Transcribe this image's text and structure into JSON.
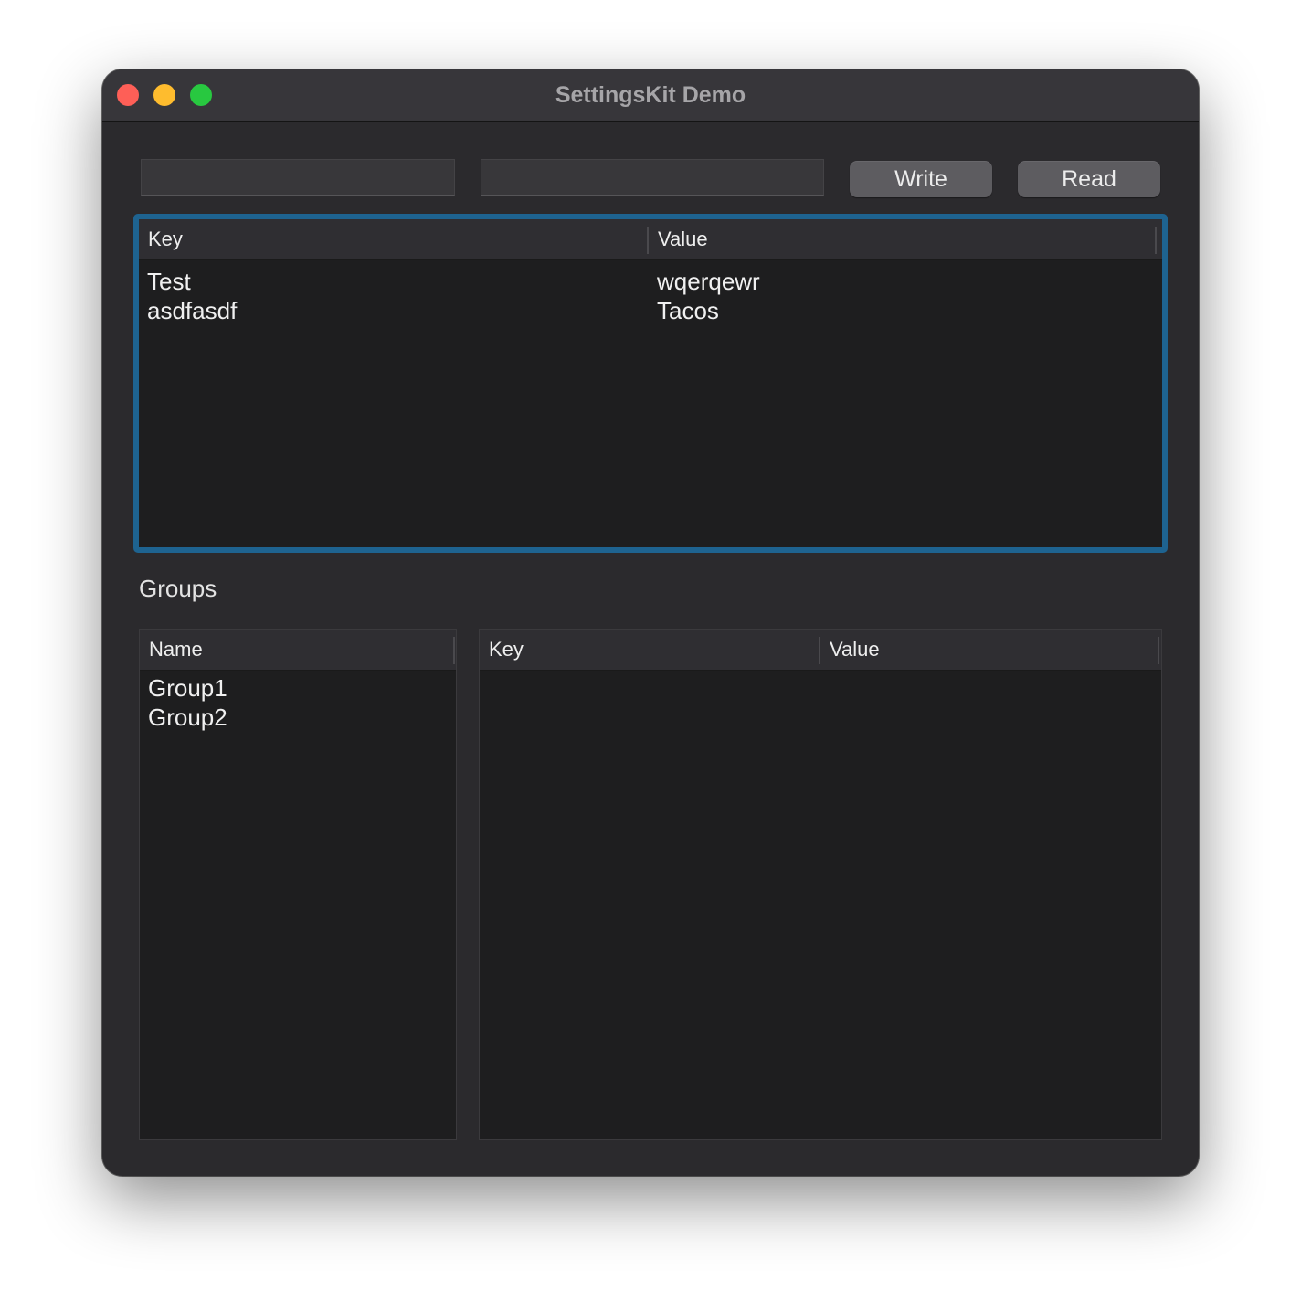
{
  "window": {
    "title": "SettingsKit Demo"
  },
  "toolbar": {
    "key_input_value": "",
    "value_input_value": "",
    "write_label": "Write",
    "read_label": "Read"
  },
  "settings_table": {
    "columns": [
      "Key",
      "Value"
    ],
    "rows": [
      {
        "key": "Test",
        "value": "wqerqewr"
      },
      {
        "key": "asdfasdf",
        "value": "Tacos"
      }
    ]
  },
  "groups": {
    "label": "Groups",
    "names_table": {
      "columns": [
        "Name"
      ],
      "rows": [
        "Group1",
        "Group2"
      ]
    },
    "group_values_table": {
      "columns": [
        "Key",
        "Value"
      ],
      "rows": []
    }
  },
  "colors": {
    "focus_ring": "#1e6390",
    "close": "#fe5f57",
    "minimize": "#febc2e",
    "zoom": "#28c840"
  }
}
